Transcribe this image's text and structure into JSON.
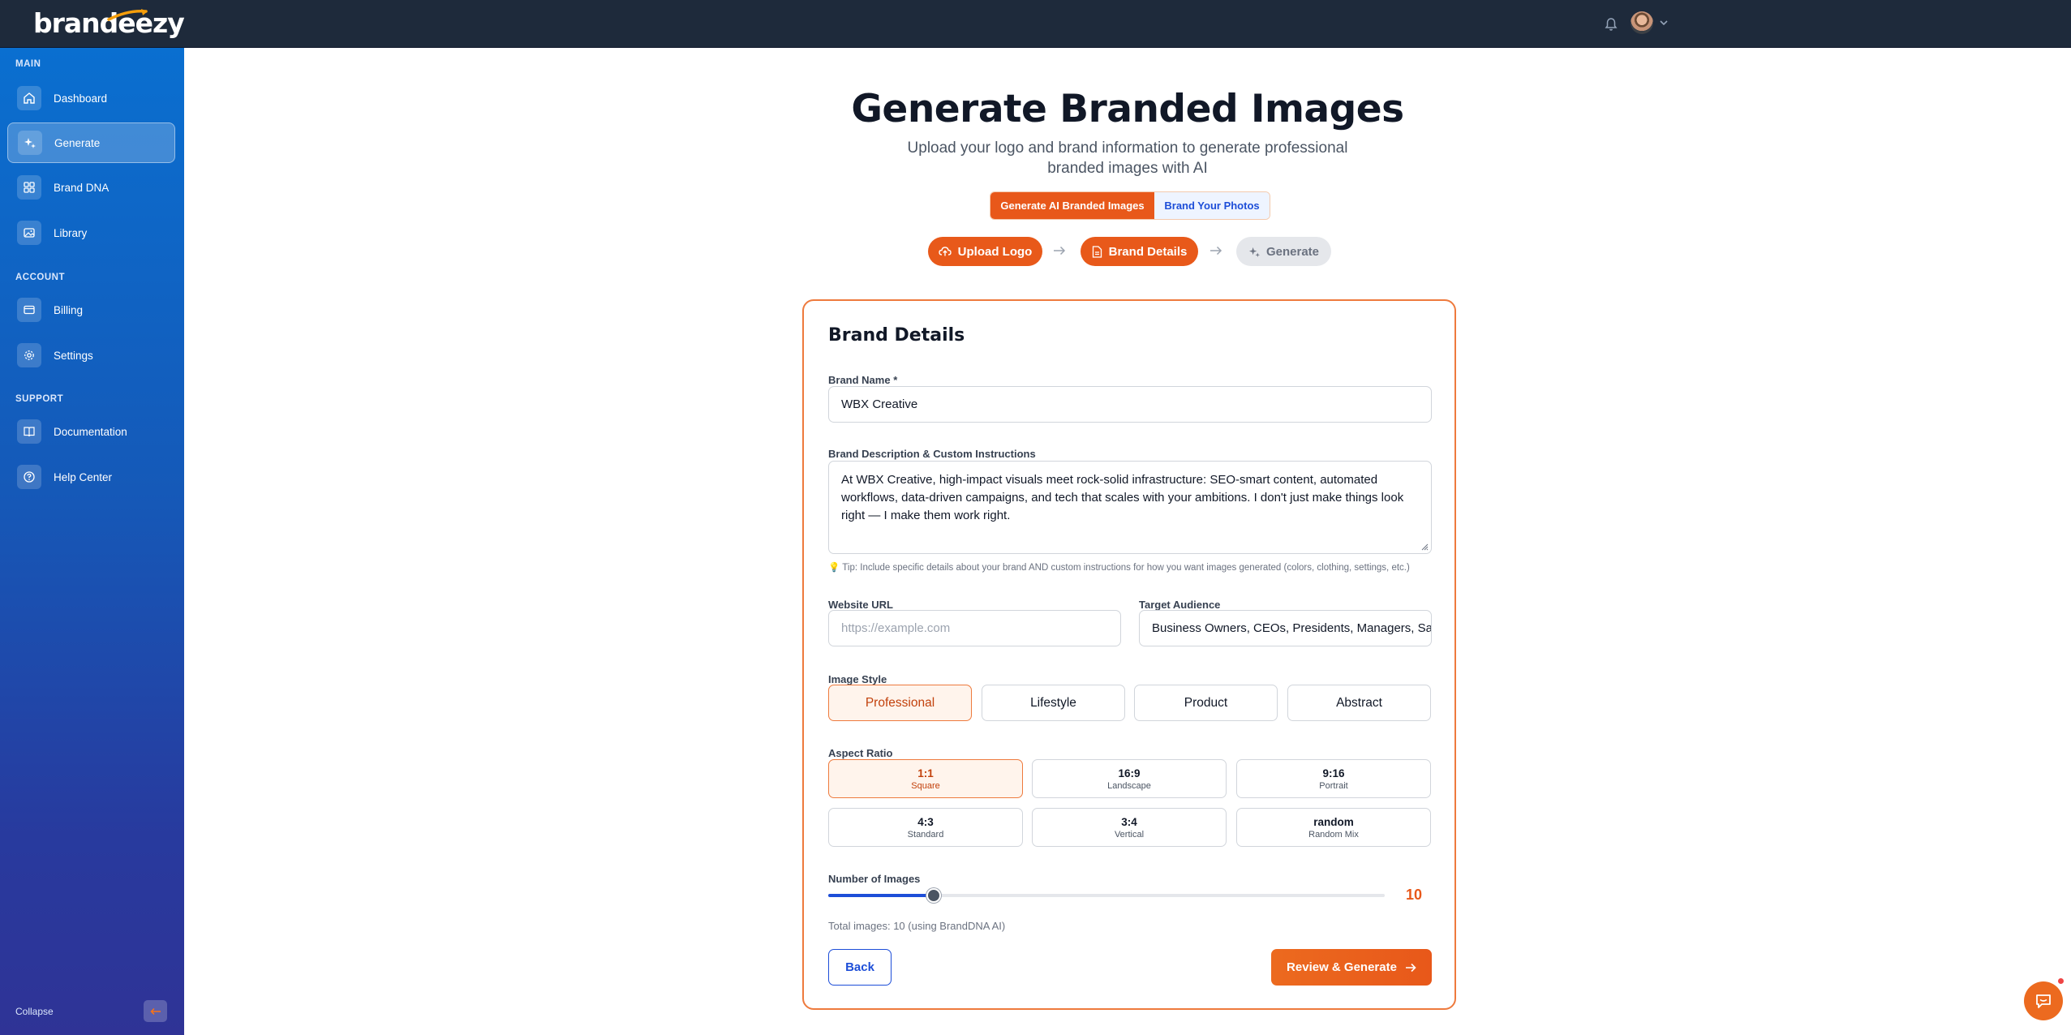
{
  "app": {
    "logo_text": "brandeezy"
  },
  "sidebar": {
    "sections": [
      {
        "title": "MAIN"
      },
      {
        "title": "ACCOUNT"
      },
      {
        "title": "SUPPORT"
      }
    ],
    "items": [
      {
        "label": "Dashboard",
        "icon": "home-icon"
      },
      {
        "label": "Generate",
        "icon": "sparkles-icon",
        "active": true
      },
      {
        "label": "Brand DNA",
        "icon": "grid-icon"
      },
      {
        "label": "Library",
        "icon": "image-icon"
      },
      {
        "label": "Billing",
        "icon": "credit-card-icon"
      },
      {
        "label": "Settings",
        "icon": "gear-icon"
      },
      {
        "label": "Documentation",
        "icon": "book-icon"
      },
      {
        "label": "Help Center",
        "icon": "help-circle-icon"
      }
    ],
    "collapse_label": "Collapse"
  },
  "header": {
    "title": "Generate Branded Images",
    "subtitle": "Upload your logo and brand information to generate professional branded images with AI"
  },
  "mode_tabs": [
    {
      "label": "Generate AI Branded Images",
      "active": true
    },
    {
      "label": "Brand Your Photos",
      "active": false
    }
  ],
  "steps": [
    {
      "label": "Upload Logo",
      "state": "done"
    },
    {
      "label": "Brand Details",
      "state": "current"
    },
    {
      "label": "Generate",
      "state": "pending"
    }
  ],
  "form": {
    "title": "Brand Details",
    "brand_name": {
      "label": "Brand Name *",
      "value": "WBX Creative"
    },
    "description": {
      "label": "Brand Description & Custom Instructions",
      "value": "At WBX Creative, high-impact visuals meet rock-solid infrastructure: SEO-smart content, automated workflows, data-driven campaigns, and tech that scales with your ambitions. I don't just make things look right — I make them work right.",
      "tip": "💡 Tip: Include specific details about your brand AND custom instructions for how you want images generated (colors, clothing, settings, etc.)"
    },
    "website": {
      "label": "Website URL",
      "value": "",
      "placeholder": "https://example.com"
    },
    "audience": {
      "label": "Target Audience",
      "value": "Business Owners, CEOs, Presidents, Managers, Sales Teams"
    },
    "image_style": {
      "label": "Image Style",
      "options": [
        "Professional",
        "Lifestyle",
        "Product",
        "Abstract"
      ],
      "selected": "Professional"
    },
    "aspect_ratio": {
      "label": "Aspect Ratio",
      "options": [
        {
          "value": "1:1",
          "label": "Square",
          "selected": true
        },
        {
          "value": "16:9",
          "label": "Landscape"
        },
        {
          "value": "9:16",
          "label": "Portrait"
        },
        {
          "value": "4:3",
          "label": "Standard"
        },
        {
          "value": "3:4",
          "label": "Vertical"
        },
        {
          "value": "random",
          "label": "Random Mix"
        }
      ]
    },
    "num_images": {
      "label": "Number of Images",
      "value": "10",
      "slider_fraction": 0.19,
      "total_text": "Total images: 10 (using BrandDNA AI)"
    },
    "back_label": "Back",
    "review_label": "Review & Generate"
  },
  "colors": {
    "accent": "#e8581a",
    "link": "#1d4ed8",
    "topbar": "#1e2a3b"
  }
}
